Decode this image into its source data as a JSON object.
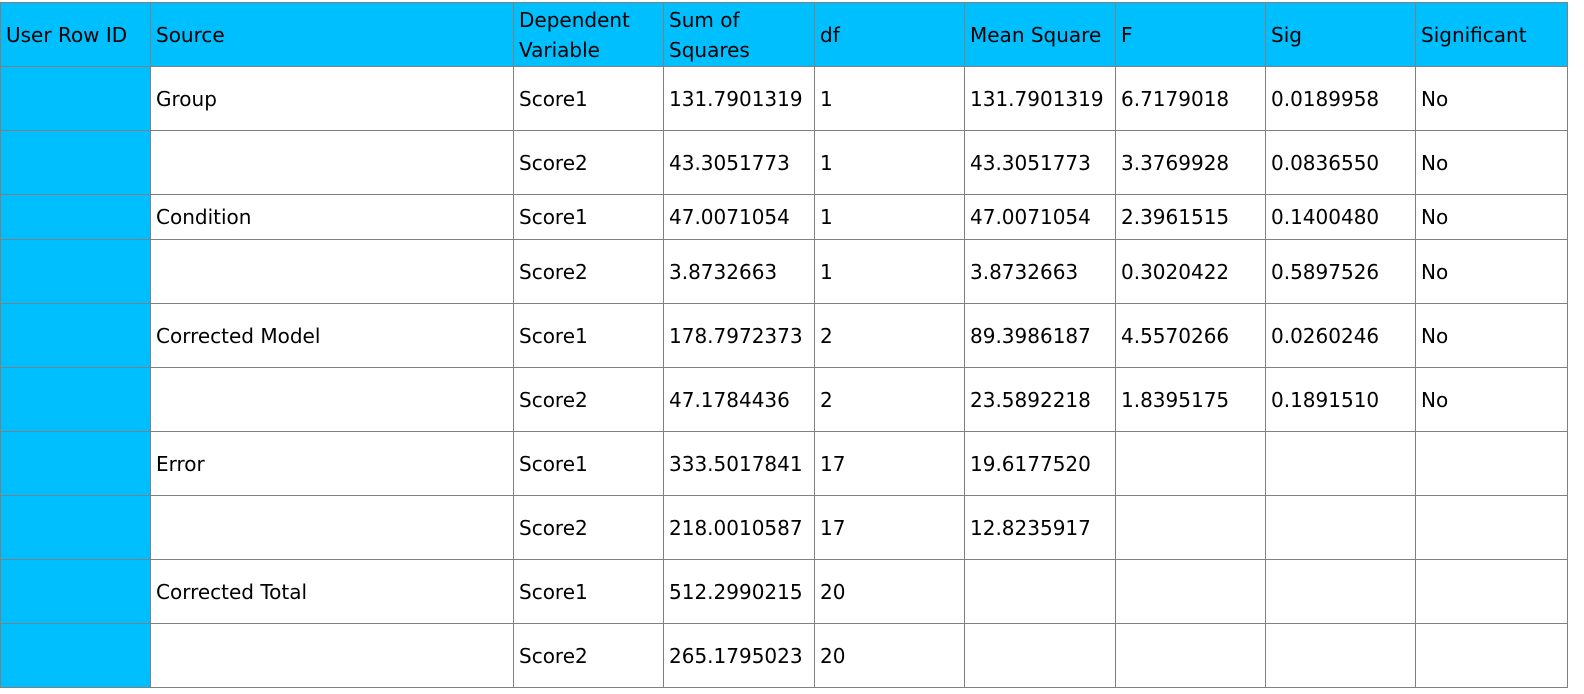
{
  "colors": {
    "header_bg": "#00bfff",
    "row_id_bg": "#00bfff",
    "grid_line": "#808080",
    "cell_bg": "#ffffff"
  },
  "table": {
    "headers": {
      "user_row_id": "User Row ID",
      "source": "Source",
      "dependent_variable": "Dependent Variable",
      "sum_of_squares": "Sum of Squares",
      "df": "df",
      "mean_square": "Mean Square",
      "f": "F",
      "sig": "Sig",
      "significant": "Significant"
    },
    "rows": [
      {
        "user_row_id": "",
        "source": "Group",
        "dependent_variable": "Score1",
        "sum_of_squares": "131.7901319",
        "df": "1",
        "mean_square": "131.7901319",
        "f": "6.7179018",
        "sig": "0.0189958",
        "significant": "No"
      },
      {
        "user_row_id": "",
        "source": "",
        "dependent_variable": "Score2",
        "sum_of_squares": "43.3051773",
        "df": "1",
        "mean_square": "43.3051773",
        "f": "3.3769928",
        "sig": "0.0836550",
        "significant": "No"
      },
      {
        "user_row_id": "",
        "source": "Condition",
        "dependent_variable": "Score1",
        "sum_of_squares": "47.0071054",
        "df": "1",
        "mean_square": "47.0071054",
        "f": "2.3961515",
        "sig": "0.1400480",
        "significant": "No"
      },
      {
        "user_row_id": "",
        "source": "",
        "dependent_variable": "Score2",
        "sum_of_squares": "3.8732663",
        "df": "1",
        "mean_square": "3.8732663",
        "f": "0.3020422",
        "sig": "0.5897526",
        "significant": "No"
      },
      {
        "user_row_id": "",
        "source": "Corrected Model",
        "dependent_variable": "Score1",
        "sum_of_squares": "178.7972373",
        "df": "2",
        "mean_square": "89.3986187",
        "f": "4.5570266",
        "sig": "0.0260246",
        "significant": "No"
      },
      {
        "user_row_id": "",
        "source": "",
        "dependent_variable": "Score2",
        "sum_of_squares": "47.1784436",
        "df": "2",
        "mean_square": "23.5892218",
        "f": "1.8395175",
        "sig": "0.1891510",
        "significant": "No"
      },
      {
        "user_row_id": "",
        "source": "Error",
        "dependent_variable": "Score1",
        "sum_of_squares": "333.5017841",
        "df": "17",
        "mean_square": "19.6177520",
        "f": "",
        "sig": "",
        "significant": ""
      },
      {
        "user_row_id": "",
        "source": "",
        "dependent_variable": "Score2",
        "sum_of_squares": "218.0010587",
        "df": "17",
        "mean_square": "12.8235917",
        "f": "",
        "sig": "",
        "significant": ""
      },
      {
        "user_row_id": "",
        "source": "Corrected Total",
        "dependent_variable": "Score1",
        "sum_of_squares": "512.2990215",
        "df": "20",
        "mean_square": "",
        "f": "",
        "sig": "",
        "significant": ""
      },
      {
        "user_row_id": "",
        "source": "",
        "dependent_variable": "Score2",
        "sum_of_squares": "265.1795023",
        "df": "20",
        "mean_square": "",
        "f": "",
        "sig": "",
        "significant": ""
      }
    ]
  }
}
